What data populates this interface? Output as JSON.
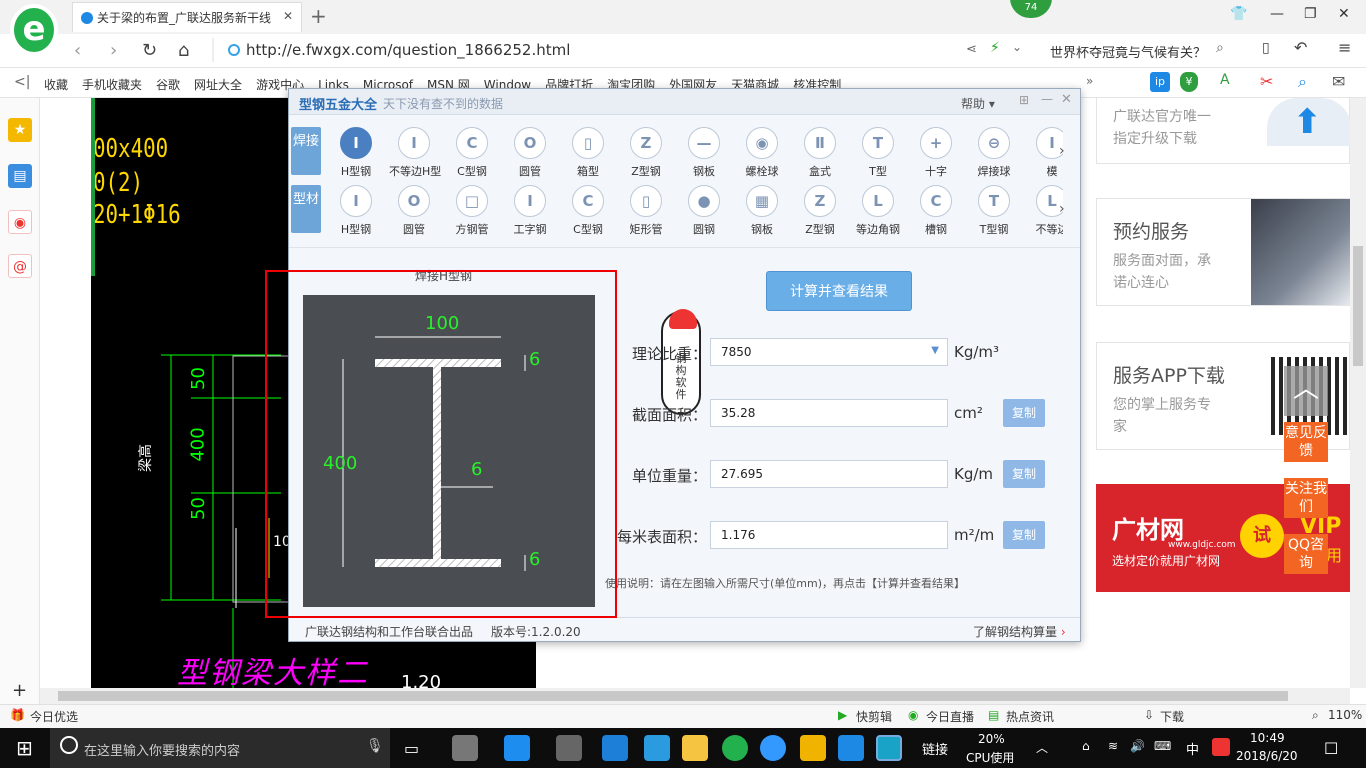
{
  "browser": {
    "tab_title": "关于梁的布置_广联达服务新干线",
    "badge": "74",
    "url": "http://e.fwxgx.com/question_1866252.html",
    "news_search": "世界杯夺冠竟与气候有关？"
  },
  "bookmarks": [
    "收藏",
    "手机收藏夹",
    "谷歌",
    "网址大全",
    "游戏中心",
    "Links",
    "Microsof",
    "MSN 网",
    "Window",
    "品牌打折",
    "淘宝团购",
    "外国网友",
    "天猫商城",
    "核准控制"
  ],
  "cad": {
    "line1": "00x400",
    "line2": "0(2)",
    "line3": "20+1Φ16",
    "dim_50_top": "50",
    "dim_400": "400",
    "dim_50_bottom": "50",
    "label_liang": "梁高",
    "dim_10": "10",
    "bottom_text": "型钢梁大样二",
    "bottom_num": "1.20"
  },
  "right_panel": {
    "box1_line1": "广联达官方唯一",
    "box1_line2": "指定升级下载",
    "box2_title": "预约服务",
    "box2_line1": "服务面对面，承",
    "box2_line2": "诺心连心",
    "box3_title": "服务APP下载",
    "box3_line1": "您的掌上服务专",
    "box3_line2": "家",
    "ad_brand": "广材网",
    "ad_site": "www.gldjc.com",
    "ad_slogan": "选材定价就用广材网",
    "ad_try": "试",
    "ad_vip": "VIP",
    "ad_use": "用"
  },
  "float_buttons": [
    "意见反馈",
    "关注我们",
    "QQ咨询"
  ],
  "dialog": {
    "title": "型钢五金大全",
    "subtitle": "天下没有查不到的数据",
    "help": "帮助",
    "cat_weld": "焊接",
    "cat_profile": "型材",
    "row1": [
      {
        "label": "H型钢",
        "glyph": "I"
      },
      {
        "label": "不等边H型",
        "glyph": "I"
      },
      {
        "label": "C型钢",
        "glyph": "C"
      },
      {
        "label": "圆管",
        "glyph": "O"
      },
      {
        "label": "箱型",
        "glyph": "▯"
      },
      {
        "label": "Z型钢",
        "glyph": "Z"
      },
      {
        "label": "钢板",
        "glyph": "—"
      },
      {
        "label": "螺栓球",
        "glyph": "◉"
      },
      {
        "label": "盒式",
        "glyph": "Ⅱ"
      },
      {
        "label": "T型",
        "glyph": "T"
      },
      {
        "label": "十字",
        "glyph": "+"
      },
      {
        "label": "焊接球",
        "glyph": "⊖"
      },
      {
        "label": "模",
        "glyph": "I"
      }
    ],
    "row2": [
      {
        "label": "H型钢",
        "glyph": "I"
      },
      {
        "label": "圆管",
        "glyph": "O"
      },
      {
        "label": "方钢管",
        "glyph": "□"
      },
      {
        "label": "工字钢",
        "glyph": "I"
      },
      {
        "label": "C型钢",
        "glyph": "C"
      },
      {
        "label": "矩形管",
        "glyph": "▯"
      },
      {
        "label": "圆钢",
        "glyph": "●"
      },
      {
        "label": "钢板",
        "glyph": "▦"
      },
      {
        "label": "Z型钢",
        "glyph": "Z"
      },
      {
        "label": "等边角钢",
        "glyph": "L"
      },
      {
        "label": "槽钢",
        "glyph": "C"
      },
      {
        "label": "T型钢",
        "glyph": "T"
      },
      {
        "label": "不等边",
        "glyph": "L"
      }
    ],
    "section_title": "焊接H型钢",
    "drawing": {
      "width": "100",
      "height": "400",
      "web": "6",
      "flange_top": "6",
      "flange_bottom": "6"
    },
    "mascot_text": "钢构软件",
    "calc_button": "计算并查看结果",
    "density_label": "理论比重：",
    "density_value": "7850",
    "density_unit": "Kg/m³",
    "area_label": "截面面积：",
    "area_value": "35.28",
    "area_unit": "cm²",
    "unit_weight_label": "单位重量：",
    "unit_weight_value": "27.695",
    "unit_weight_unit": "Kg/m",
    "surface_label": "每米表面积：",
    "surface_value": "1.176",
    "surface_unit": "m²/m",
    "copy_label": "复制",
    "usage": "使用说明：请在左图输入所需尺寸(单位mm)，再点击【计算并查看结果】",
    "footer_left": "广联达钢结构和工作台联合出品",
    "version": "版本号:1.2.0.20",
    "footer_right": "了解钢结构算量"
  },
  "statusbar": {
    "left": "今日优选",
    "items": [
      "快剪辑",
      "今日直播",
      "热点资讯",
      "下载"
    ],
    "zoom": "110%"
  },
  "taskbar": {
    "search_placeholder": "在这里输入你要搜索的内容",
    "link": "链接",
    "cpu_pct": "20%",
    "cpu_label": "CPU使用",
    "ime": "中",
    "time": "10:49",
    "date": "2018/6/20"
  }
}
